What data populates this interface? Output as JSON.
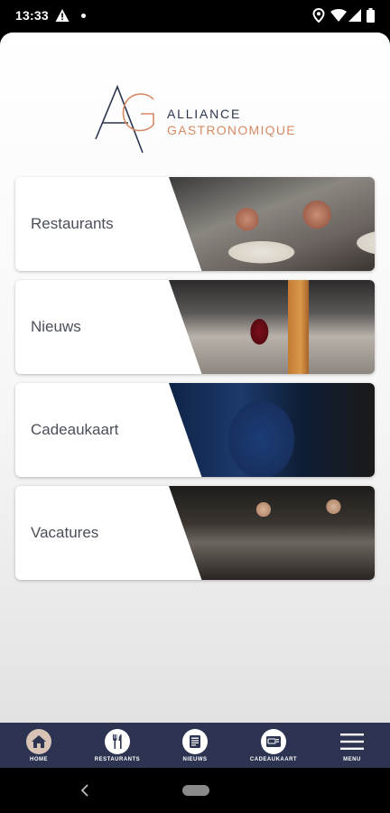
{
  "status_bar": {
    "time": "13:33",
    "icons": [
      "warning-icon",
      "notification-dot",
      "location-icon",
      "wifi-icon",
      "signal-icon",
      "battery-icon"
    ]
  },
  "logo": {
    "monogram": "AG",
    "line1": "ALLIANCE",
    "line2": "GASTRONOMIQUE",
    "colors": {
      "navy": "#2b3550",
      "copper": "#d68a63"
    }
  },
  "menu_cards": [
    {
      "label": "Restaurants"
    },
    {
      "label": "Nieuws"
    },
    {
      "label": "Cadeaukaart"
    },
    {
      "label": "Vacatures"
    }
  ],
  "bottom_nav": {
    "items": [
      {
        "label": "HOME",
        "icon": "home-icon",
        "active": true
      },
      {
        "label": "RESTAURANTS",
        "icon": "cutlery-icon"
      },
      {
        "label": "NIEUWS",
        "icon": "newspaper-icon"
      },
      {
        "label": "CADEAUKAART",
        "icon": "giftcard-icon"
      },
      {
        "label": "MENU",
        "icon": "hamburger-icon"
      }
    ],
    "background": "#2c3452"
  },
  "system_nav": {
    "icons": [
      "back-icon",
      "home-pill"
    ]
  }
}
